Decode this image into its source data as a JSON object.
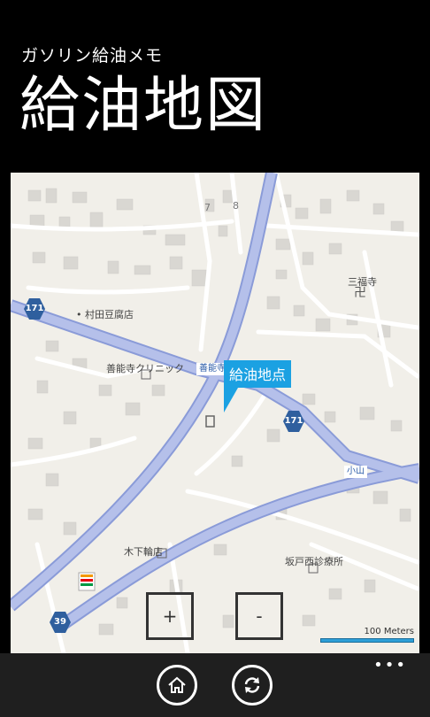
{
  "app": {
    "subtitle": "ガソリン給油メモ",
    "title": "給油地図"
  },
  "map": {
    "pin_label": "給油地点",
    "labels": {
      "shop": "村田豆腐店",
      "clinic": "善能寺クリニック",
      "temple": "三福寺",
      "kinoshita": "木下輪店",
      "sakado": "坂戸西診療所",
      "num7": "7",
      "num8": "8"
    },
    "streets": {
      "zennoji": "善能寺",
      "koyama": "小山"
    },
    "routes": {
      "r171_west": "171",
      "r171_east": "171",
      "r39": "39"
    },
    "scale_label": "100 Meters",
    "zoom_in_label": "+",
    "zoom_out_label": "-",
    "colors": {
      "background": "#f1efe9",
      "major_road": "#a9b6e3",
      "minor_road": "#ffffff",
      "building": "#d8d6d1",
      "shield": "#2f5f9e",
      "pin": "#1ba1e2"
    }
  },
  "appbar": {
    "home_icon": "home-icon",
    "refresh_icon": "refresh-icon",
    "more_label": "•••"
  }
}
